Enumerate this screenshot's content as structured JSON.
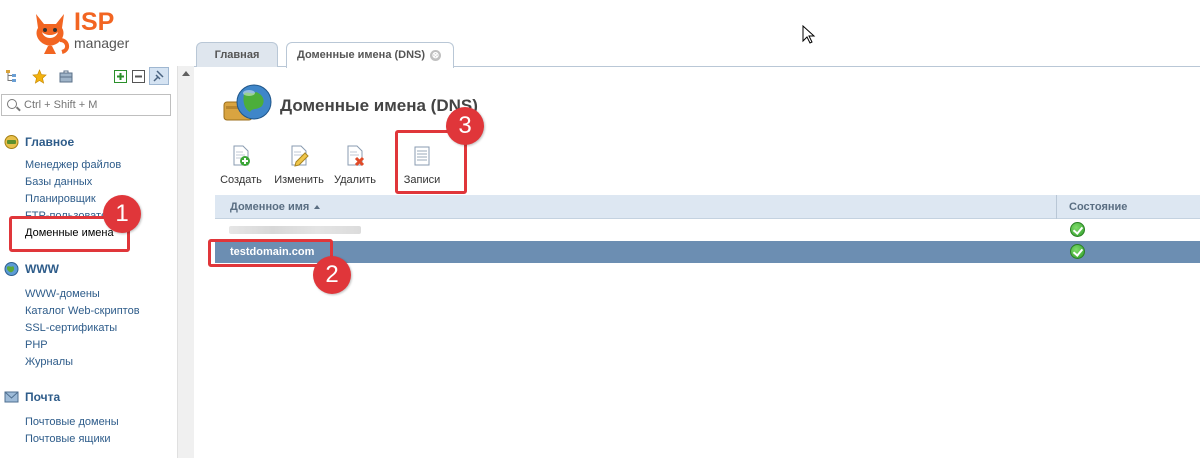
{
  "logo": {
    "isp": "ISP",
    "manager": "manager"
  },
  "sidebar": {
    "tool_icons": [
      "tree-icon",
      "star-icon",
      "briefcase-icon",
      "expand-all-icon",
      "collapse-all-icon",
      "pin-icon"
    ],
    "search_placeholder": "Ctrl + Shift + M",
    "groups": [
      {
        "title": "Главное",
        "icon": "main-icon",
        "items": [
          "Менеджер файлов",
          "Базы данных",
          "Планировщик",
          "FTP-пользователи",
          "Доменные имена"
        ]
      },
      {
        "title": "WWW",
        "icon": "www-icon",
        "items": [
          "WWW-домены",
          "Каталог Web-скриптов",
          "SSL-сертификаты",
          "PHP",
          "Журналы"
        ]
      },
      {
        "title": "Почта",
        "icon": "mail-icon",
        "items": [
          "Почтовые домены",
          "Почтовые ящики"
        ]
      }
    ]
  },
  "tabs": [
    {
      "label": "Главная",
      "active": false
    },
    {
      "label": "Доменные имена (DNS)",
      "active": true,
      "close": "⊗"
    }
  ],
  "page": {
    "title": "Доменные имена (DNS)"
  },
  "toolbar": {
    "create": "Создать",
    "edit": "Изменить",
    "delete": "Удалить",
    "records": "Записи"
  },
  "grid": {
    "columns": [
      "Доменное имя",
      "Состояние"
    ],
    "rows": [
      {
        "domain": "",
        "status": "ok",
        "selected": false
      },
      {
        "domain": "testdomain.com",
        "status": "ok",
        "selected": true
      }
    ]
  },
  "annotations": [
    "1",
    "2",
    "3"
  ],
  "colors": {
    "accent_red": "#e0363a",
    "selected_row": "#6c8eb2",
    "link_blue": "#2e5c8a",
    "logo_orange": "#f26522"
  }
}
